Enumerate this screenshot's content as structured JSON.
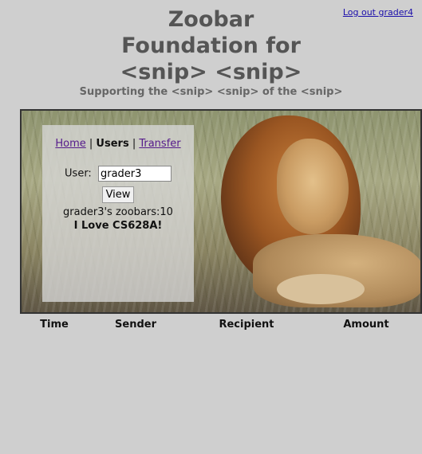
{
  "header": {
    "logout": "Log out grader4",
    "title_lines": [
      "Zoobar",
      "Foundation for",
      "<snip> <snip>"
    ],
    "subtitle": "Supporting the <snip> <snip> of the <snip>"
  },
  "nav": {
    "home": "Home",
    "sep1": " | ",
    "users": "Users",
    "sep2": " | ",
    "transfer": "Transfer"
  },
  "lookup": {
    "label": "User:",
    "value": "grader3",
    "button": "View"
  },
  "result": {
    "zoobars": "grader3's zoobars:10",
    "profile": "I Love CS628A!"
  },
  "table": {
    "headers": [
      "Time",
      "Sender",
      "Recipient",
      "Amount"
    ]
  }
}
